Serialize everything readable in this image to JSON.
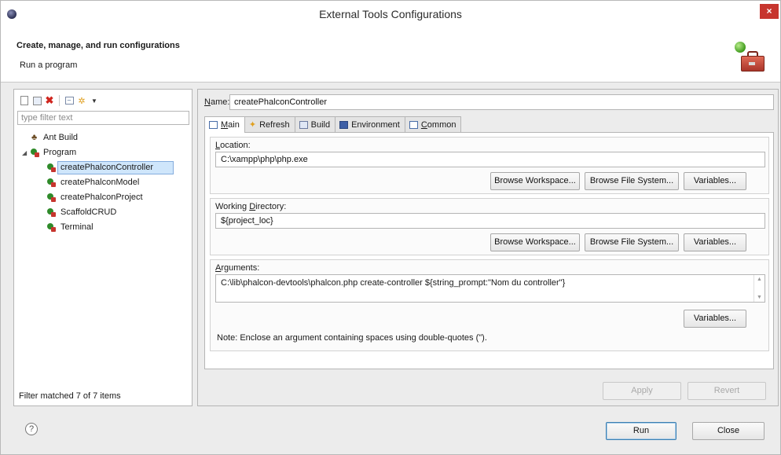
{
  "window": {
    "title": "External Tools Configurations",
    "close_glyph": "×"
  },
  "header": {
    "title": "Create, manage, and run configurations",
    "subtitle": "Run a program"
  },
  "left": {
    "filter_placeholder": "type filter text",
    "tree": [
      {
        "label": "Ant Build",
        "icon": "ant-icon",
        "level": 0
      },
      {
        "label": "Program",
        "icon": "program-icon",
        "level": 0,
        "expanded": true
      },
      {
        "label": "createPhalconController",
        "icon": "program-launch-icon",
        "level": 1,
        "selected": true
      },
      {
        "label": "createPhalconModel",
        "icon": "program-launch-icon",
        "level": 1
      },
      {
        "label": "createPhalconProject",
        "icon": "program-launch-icon",
        "level": 1
      },
      {
        "label": "ScaffoldCRUD",
        "icon": "program-launch-icon",
        "level": 1
      },
      {
        "label": "Terminal",
        "icon": "program-launch-icon",
        "level": 1
      }
    ],
    "footer": "Filter matched 7 of 7 items"
  },
  "right": {
    "name_label_u": "N",
    "name_label_rest": "ame:",
    "name_value": "createPhalconController",
    "tabs": [
      {
        "label_u": "M",
        "label_rest": "ain",
        "icon": "main-tab-icon"
      },
      {
        "label": "Refresh",
        "icon": "refresh-icon"
      },
      {
        "label": "Build",
        "icon": "build-icon"
      },
      {
        "label": "Environment",
        "icon": "environment-icon"
      },
      {
        "label_u": "C",
        "label_rest": "ommon",
        "icon": "common-icon"
      }
    ],
    "location": {
      "label_u": "L",
      "label_rest": "ocation:",
      "value": "C:\\xampp\\php\\php.exe",
      "buttons": [
        "Browse Workspace...",
        "Browse File System...",
        "Variables..."
      ]
    },
    "working_dir": {
      "label_pre": "Working ",
      "label_u": "D",
      "label_rest": "irectory:",
      "value": "${project_loc}",
      "buttons": [
        "Browse Workspace...",
        "Browse File System...",
        "Variables..."
      ]
    },
    "arguments": {
      "label_u": "A",
      "label_rest": "rguments:",
      "value": "C:\\lib\\phalcon-devtools\\phalcon.php create-controller ${string_prompt:\"Nom du controller\"}",
      "button": "Variables...",
      "note": "Note: Enclose an argument containing spaces using double-quotes (\")."
    },
    "apply": "Apply",
    "revert": "Revert"
  },
  "footer": {
    "help_glyph": "?",
    "run": "Run",
    "close": "Close"
  }
}
